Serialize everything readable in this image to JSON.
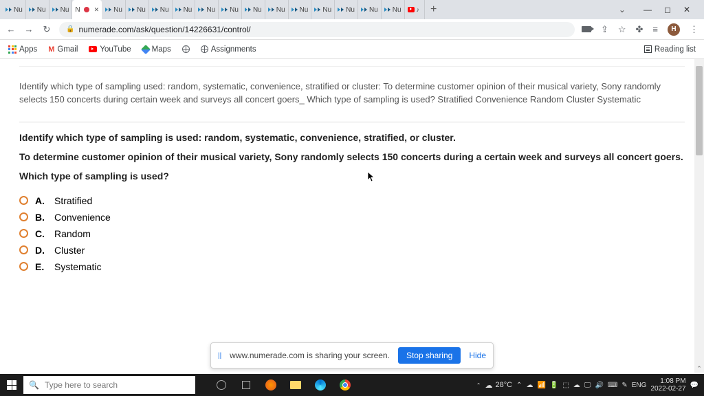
{
  "browser": {
    "url": "numerade.com/ask/question/14226631/control/",
    "tabs": [
      {
        "icon": "nu",
        "label": "Nu"
      },
      {
        "icon": "nu",
        "label": "Nu"
      },
      {
        "icon": "nu",
        "label": "Nu"
      },
      {
        "icon": "rec",
        "label": "N"
      },
      {
        "icon": "nu",
        "label": "Nu"
      },
      {
        "icon": "nu",
        "label": "Nu"
      },
      {
        "icon": "nu",
        "label": "Nu"
      },
      {
        "icon": "nu",
        "label": "Nu"
      },
      {
        "icon": "nu",
        "label": "Nu"
      },
      {
        "icon": "nu",
        "label": "Nu"
      },
      {
        "icon": "nu",
        "label": "Nu"
      },
      {
        "icon": "nu",
        "label": "Nu"
      },
      {
        "icon": "nu",
        "label": "Nu"
      },
      {
        "icon": "nu",
        "label": "Nu"
      },
      {
        "icon": "nu",
        "label": "Nu"
      },
      {
        "icon": "nu",
        "label": "Nu"
      },
      {
        "icon": "nu",
        "label": "Nu"
      },
      {
        "icon": "yt",
        "label": ""
      }
    ],
    "active_tab_index": 3,
    "wincontrols": {
      "chev": "⌄",
      "min": "—",
      "max": "◻",
      "close": "✕"
    }
  },
  "bookmarks": {
    "apps": "Apps",
    "gmail": "Gmail",
    "youtube": "YouTube",
    "maps": "Maps",
    "globe1": "",
    "assignments": "Assignments",
    "reading_list": "Reading list"
  },
  "nav_right": {
    "avatar_letter": "H"
  },
  "content": {
    "summary": "Identify which type of sampling used: random, systematic, convenience, stratified or cluster: To determine customer opinion of their musical variety, Sony randomly selects 150 concerts during certain week and surveys all concert goers_ Which type of sampling is used? Stratified Convenience Random Cluster Systematic",
    "line1": "Identify which type of sampling is used: random, systematic, convenience, stratified, or cluster.",
    "line2": "To determine customer opinion of their musical variety, Sony randomly selects 150 concerts during a certain week and surveys all concert goers.",
    "line3": "Which type of sampling is used?",
    "options": [
      {
        "letter": "A.",
        "text": "Stratified"
      },
      {
        "letter": "B.",
        "text": "Convenience"
      },
      {
        "letter": "C.",
        "text": "Random"
      },
      {
        "letter": "D.",
        "text": "Cluster"
      },
      {
        "letter": "E.",
        "text": "Systematic"
      }
    ]
  },
  "share_bar": {
    "msg": "www.numerade.com is sharing your screen.",
    "stop": "Stop sharing",
    "hide": "Hide"
  },
  "taskbar": {
    "search_placeholder": "Type here to search",
    "temp": "28°C",
    "lang": "ENG",
    "time": "1:08 PM",
    "date": "2022-02-27"
  }
}
